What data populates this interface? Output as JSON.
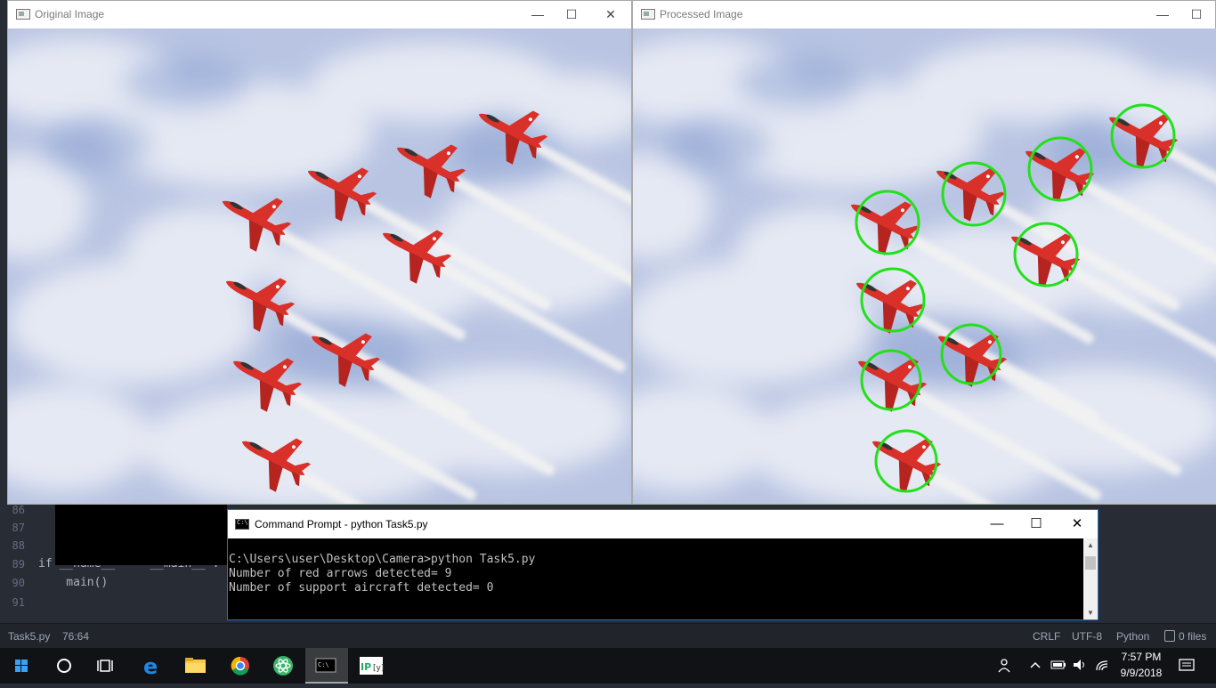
{
  "editor": {
    "lines": [
      {
        "num": "86",
        "code": ""
      },
      {
        "num": "87",
        "code": ""
      },
      {
        "num": "88",
        "code": ""
      },
      {
        "num": "89",
        "code": "if __name__ == '__main__':"
      },
      {
        "num": "90",
        "code": "    main()"
      },
      {
        "num": "91",
        "code": ""
      }
    ]
  },
  "windows": {
    "original": {
      "title": "Original Image"
    },
    "processed": {
      "title": "Processed Image"
    }
  },
  "window_buttons": {
    "minimize": "—",
    "maximize": "☐",
    "close": "✕"
  },
  "cmd": {
    "title": "Command Prompt - python  Task5.py",
    "lines": [
      "C:\\Users\\user\\Desktop\\Camera>python Task5.py",
      "Number of red arrows detected= 9",
      "Number of support aircraft detected= 0"
    ]
  },
  "statusbar": {
    "file": "Task5.py",
    "cursor": "76:64",
    "line_ending": "CRLF",
    "encoding": "UTF-8",
    "grammar": "Python",
    "files": "0 files"
  },
  "taskbar": {
    "time": "7:57 PM",
    "date": "9/9/2018",
    "apps": [
      "windows-start",
      "cortana",
      "task-view",
      "edge",
      "file-explorer",
      "chrome",
      "atom",
      "command-prompt",
      "ipython"
    ]
  },
  "colors": {
    "sky": "#b8c4e2",
    "jet": "#d9302a",
    "smoke": "#f2f2f2",
    "detection_circle": "#22e01a"
  }
}
